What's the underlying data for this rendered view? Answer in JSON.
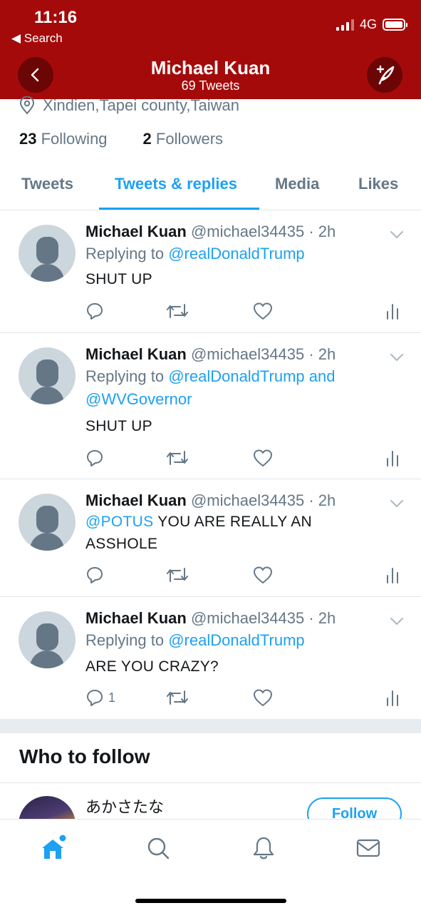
{
  "status_bar": {
    "time": "11:16",
    "back_label": "Search",
    "network": "4G"
  },
  "header": {
    "title": "Michael Kuan",
    "subtitle": "69 Tweets"
  },
  "profile": {
    "location": "Xindien,Tapei county,Taiwan",
    "following_count": "23",
    "following_label": "Following",
    "followers_count": "2",
    "followers_label": "Followers"
  },
  "tabs": [
    {
      "label": "Tweets"
    },
    {
      "label": "Tweets & replies"
    },
    {
      "label": "Media"
    },
    {
      "label": "Likes"
    }
  ],
  "active_tab": "Tweets & replies",
  "tweets": [
    {
      "name": "Michael Kuan",
      "handle_time": "@michael34435 · 2h",
      "reply_prefix": "Replying to ",
      "reply_mention_1": "@realDonaldTrump",
      "reply_joiner": "",
      "reply_mention_2": "",
      "mention": "",
      "text": "SHUT UP",
      "reply_count": ""
    },
    {
      "name": "Michael Kuan",
      "handle_time": "@michael34435 · 2h",
      "reply_prefix": "Replying to ",
      "reply_mention_1": "@realDonaldTrump and",
      "reply_joiner": " ",
      "reply_mention_2": "@WVGovernor",
      "mention": "",
      "text": "SHUT UP",
      "reply_count": ""
    },
    {
      "name": "Michael Kuan",
      "handle_time": "@michael34435 · 2h",
      "reply_prefix": "",
      "reply_mention_1": "",
      "reply_joiner": "",
      "reply_mention_2": "",
      "mention": "@POTUS",
      "text": " YOU ARE REALLY AN ASSHOLE",
      "reply_count": ""
    },
    {
      "name": "Michael Kuan",
      "handle_time": "@michael34435 · 2h",
      "reply_prefix": "Replying to ",
      "reply_mention_1": "@realDonaldTrump",
      "reply_joiner": "",
      "reply_mention_2": "",
      "mention": "",
      "text": "ARE YOU CRAZY?",
      "reply_count": "1"
    }
  ],
  "who_to_follow": {
    "title": "Who to follow",
    "suggestion_name": "あかさたな",
    "follow_label": "Follow"
  },
  "colors": {
    "header_bg": "#a50a0a",
    "accent": "#1da1f2",
    "muted": "#657786"
  },
  "icons": {
    "location": "location-pin-icon",
    "reply": "reply-icon",
    "retweet": "retweet-icon",
    "like": "heart-icon",
    "analytics": "analytics-icon",
    "nav": [
      "home-icon",
      "search-icon",
      "bell-icon",
      "mail-icon"
    ]
  }
}
